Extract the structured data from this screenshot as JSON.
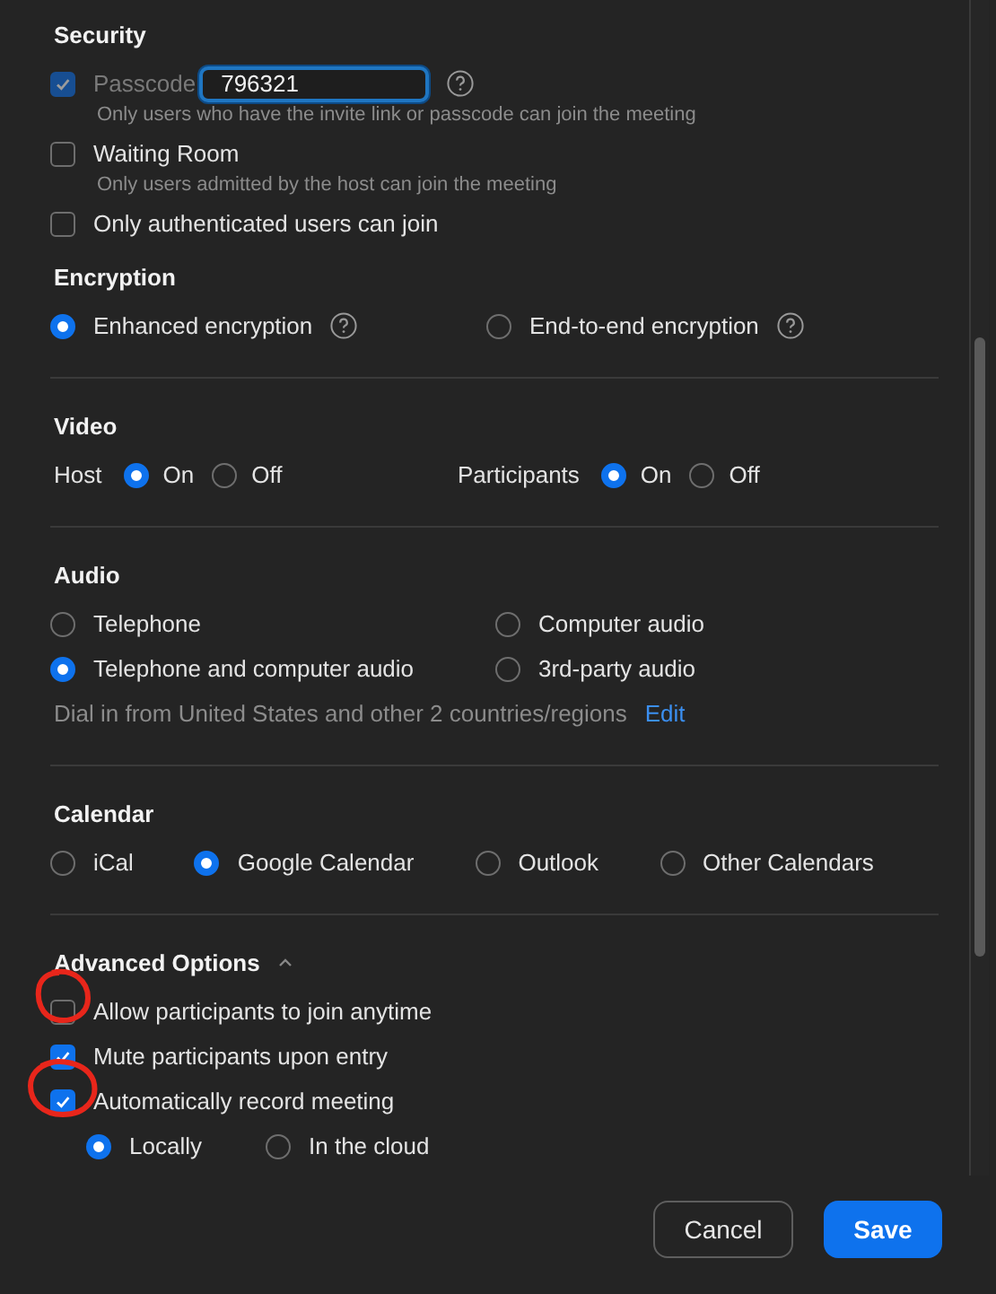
{
  "sections": [
    {
      "title": "Security",
      "kind": "checks",
      "divided": false,
      "items": [
        {
          "label": "Passcode",
          "checked": true,
          "disabled": true,
          "field": {
            "value": "796321"
          },
          "help": true,
          "hint": "Only users who have the invite link or passcode can join the meeting"
        },
        {
          "label": "Waiting Room",
          "checked": false,
          "disabled": false,
          "help": false,
          "hint": "Only users admitted by the host can join the meeting"
        },
        {
          "label": "Only authenticated users can join",
          "checked": false,
          "disabled": false,
          "help": false
        }
      ]
    },
    {
      "title": "Encryption",
      "kind": "radio_grid",
      "divided": false,
      "options": [
        {
          "label": "Enhanced encryption",
          "selected": true,
          "help": true
        },
        {
          "label": "End-to-end encryption",
          "selected": false,
          "help": true
        }
      ]
    },
    {
      "title": "Video",
      "kind": "radio_groups",
      "divided": true,
      "groups": [
        {
          "label": "Host",
          "options": [
            {
              "label": "On",
              "selected": true
            },
            {
              "label": "Off",
              "selected": false
            }
          ]
        },
        {
          "label": "Participants",
          "options": [
            {
              "label": "On",
              "selected": true
            },
            {
              "label": "Off",
              "selected": false
            }
          ]
        }
      ]
    },
    {
      "title": "Audio",
      "kind": "radio_grid",
      "divided": true,
      "options": [
        {
          "label": "Telephone",
          "selected": false
        },
        {
          "label": "Computer audio",
          "selected": false
        },
        {
          "label": "Telephone and computer audio",
          "selected": true
        },
        {
          "label": "3rd-party audio",
          "selected": false
        }
      ],
      "note": {
        "text": "Dial in from United States and other 2 countries/regions",
        "link": "Edit"
      }
    },
    {
      "title": "Calendar",
      "kind": "radio_row",
      "divided": true,
      "options": [
        {
          "label": "iCal",
          "selected": false
        },
        {
          "label": "Google Calendar",
          "selected": true
        },
        {
          "label": "Outlook",
          "selected": false
        },
        {
          "label": "Other Calendars",
          "selected": false
        }
      ]
    },
    {
      "title": "Advanced Options",
      "kind": "checks",
      "divided": true,
      "expanded": true,
      "items": [
        {
          "label": "Allow participants to join anytime",
          "checked": false,
          "disabled": false
        },
        {
          "label": "Mute participants upon entry",
          "checked": true,
          "disabled": false
        },
        {
          "label": "Automatically record meeting",
          "checked": true,
          "disabled": false,
          "options": [
            {
              "label": "Locally",
              "selected": true
            },
            {
              "label": "In the cloud",
              "selected": false
            }
          ]
        }
      ]
    }
  ],
  "buttons": [
    {
      "label": "Cancel",
      "primary": false
    },
    {
      "label": "Save",
      "primary": true
    }
  ]
}
